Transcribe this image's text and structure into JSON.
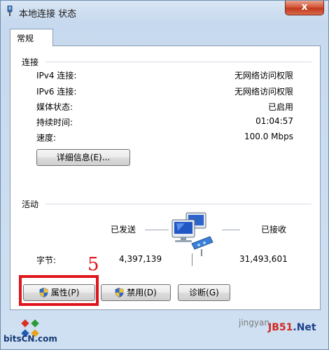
{
  "window": {
    "title": "本地连接 状态",
    "close_symbol": "x"
  },
  "tabs": [
    {
      "label": "常规"
    }
  ],
  "connection": {
    "heading": "连接",
    "rows": [
      {
        "label": "IPv4 连接:",
        "value": "无网络访问权限"
      },
      {
        "label": "IPv6 连接:",
        "value": "无网络访问权限"
      },
      {
        "label": "媒体状态:",
        "value": "已启用"
      },
      {
        "label": "持续时间:",
        "value": "01:04:57"
      },
      {
        "label": "速度:",
        "value": "100.0 Mbps"
      }
    ],
    "details_button": "详细信息(E)..."
  },
  "activity": {
    "heading": "活动",
    "sent_label": "已发送",
    "received_label": "已接收",
    "bytes_label": "字节:",
    "bytes_sent": "4,397,139",
    "bytes_received": "31,493,601"
  },
  "buttons": {
    "properties": "属性(P)",
    "disable": "禁用(D)",
    "diagnose": "诊断(G)"
  },
  "annotation": {
    "step_number": "5"
  },
  "watermarks": {
    "left": "bitsCN.com",
    "right_small": "jingyan",
    "right_main_red": "JB51",
    "right_main_blue": ".Net"
  },
  "icons": {
    "title": "network-adapter-icon",
    "activity": "network-computers-icon",
    "shield": "uac-shield-icon"
  },
  "colors": {
    "annotation_red": "#e0141b",
    "close_red": "#c1391c"
  }
}
